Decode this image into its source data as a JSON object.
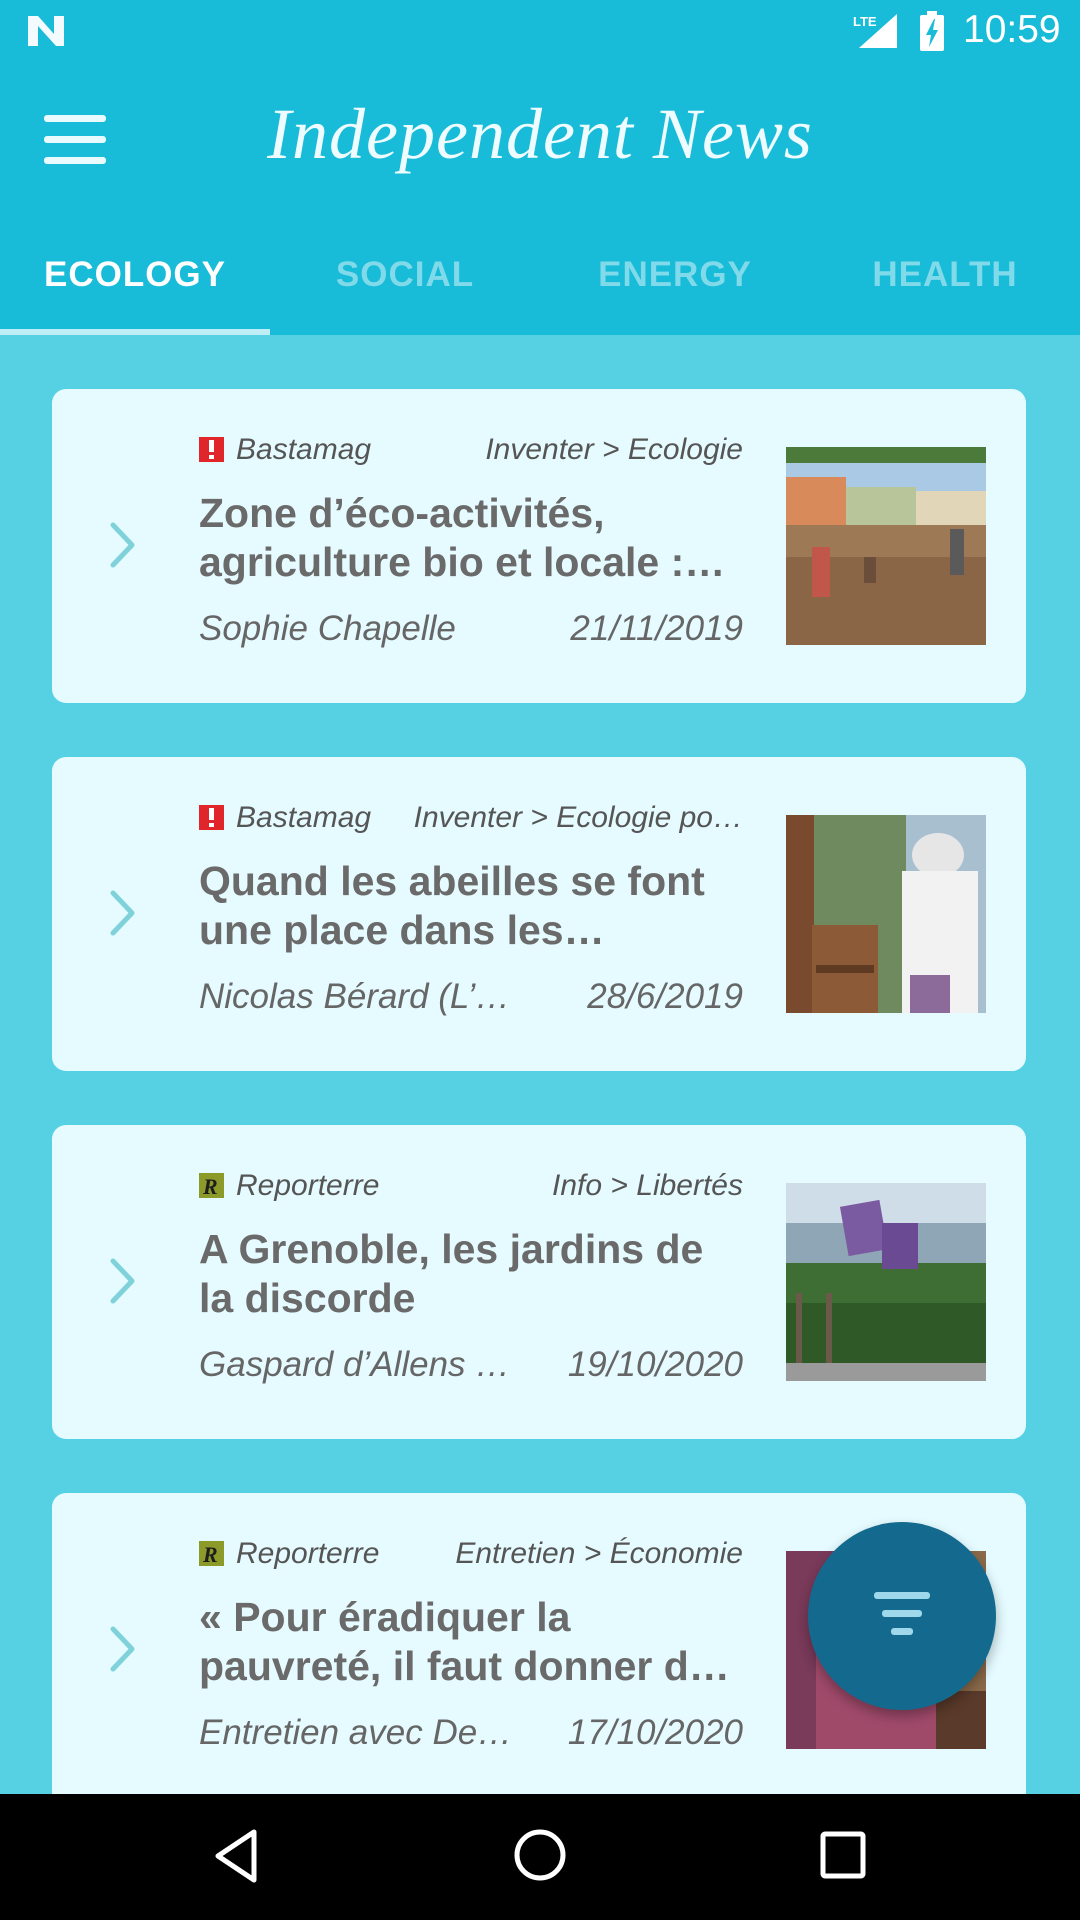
{
  "status_bar": {
    "network": "LTE",
    "time": "10:59",
    "icons": [
      "n-logo-icon",
      "lte-signal-icon",
      "battery-charging-icon"
    ]
  },
  "app_bar": {
    "title": "Independent News",
    "menu_icon": "hamburger-menu-icon"
  },
  "tabs": [
    {
      "label": "ECOLOGY",
      "active": true
    },
    {
      "label": "SOCIAL",
      "active": false
    },
    {
      "label": "ENERGY",
      "active": false
    },
    {
      "label": "HEALTH",
      "active": false
    }
  ],
  "articles": [
    {
      "source": "Bastamag",
      "source_icon": "bastamag-icon",
      "section": "Inventer > Ecologie",
      "title": "Zone d’éco-activités, agriculture bio et locale : u…",
      "author": "Sophie Chapelle",
      "date": "21/11/2019",
      "thumbnail": "gardeners-field-photo"
    },
    {
      "source": "Bastamag",
      "source_icon": "bastamag-icon",
      "section": "Inventer > Ecologie po…",
      "title": "Quand les abeilles se font une place dans les quartier…",
      "author": "Nicolas Bérard (L’â…",
      "date": "28/6/2019",
      "thumbnail": "beekeeper-photo"
    },
    {
      "source": "Reporterre",
      "source_icon": "reporterre-icon",
      "section": "Info > Libertés",
      "title": "A Grenoble, les jardins de la discorde",
      "author": "Gaspard d’Allens …",
      "date": "19/10/2020",
      "thumbnail": "garden-signs-photo"
    },
    {
      "source": "Reporterre",
      "source_icon": "reporterre-icon",
      "section": "Entretien > Économie",
      "title": "« Pour éradiquer la pauvreté, il faut donner de l’argent a",
      "author": "Entretien avec De…",
      "date": "17/10/2020",
      "thumbnail": "person-photo"
    }
  ],
  "fab": {
    "icon": "filter-icon"
  },
  "nav_bar": {
    "icons": [
      "back-icon",
      "home-icon",
      "recents-icon"
    ]
  },
  "colors": {
    "primary": "#18bcd8",
    "background": "#55d1e3",
    "card": "#e5fbff",
    "fab": "#146a8e",
    "bastamag_red": "#e0262a",
    "reporterre_olive": "#8c9a2a"
  }
}
